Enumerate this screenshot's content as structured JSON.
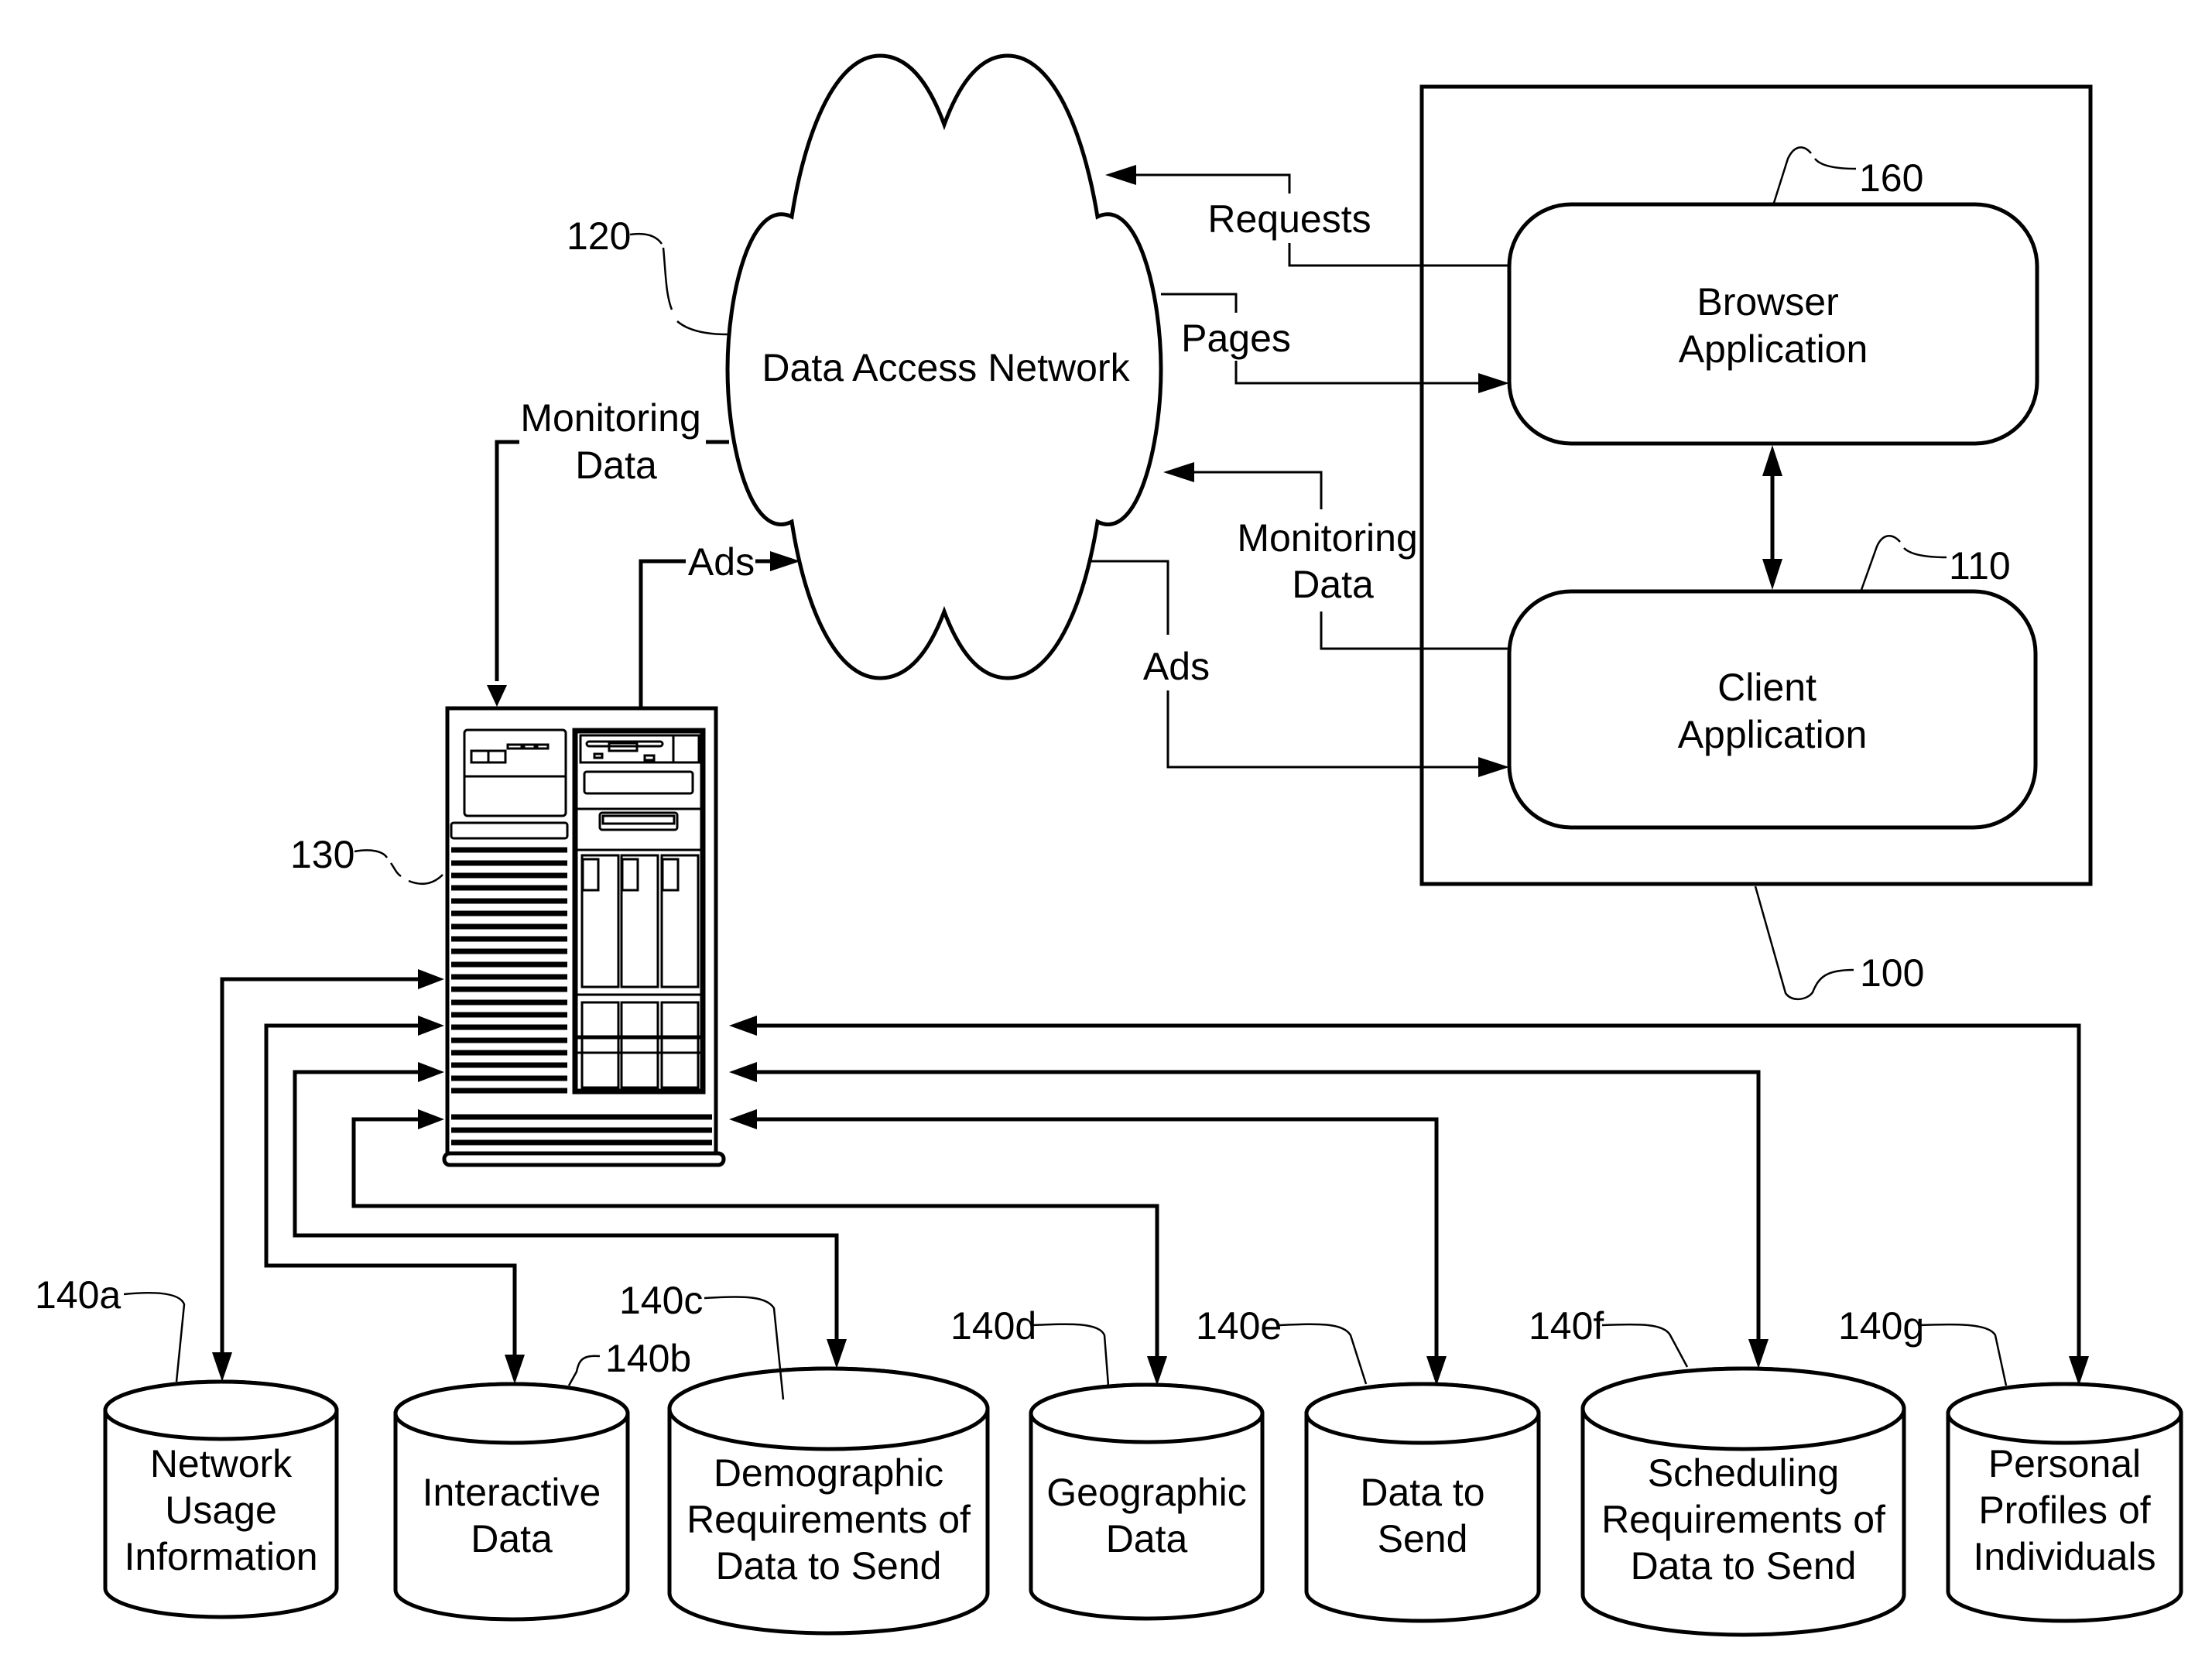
{
  "figure": {
    "type": "patent-block-diagram",
    "colors": {
      "line": "#000000",
      "background": "#ffffff"
    }
  },
  "network": {
    "ref": "120",
    "label": "Data Access Network"
  },
  "server": {
    "ref": "130",
    "icon": "server-tower-icon"
  },
  "client_system": {
    "ref": "100",
    "browser": {
      "ref": "160",
      "lines": [
        "Browser",
        "Application"
      ]
    },
    "client": {
      "ref": "110",
      "lines": [
        "Client",
        "Application"
      ]
    }
  },
  "flows": {
    "requests": "Requests",
    "pages": "Pages",
    "monitoring_right": [
      "Monitoring",
      "Data"
    ],
    "ads_right": "Ads",
    "monitoring_left": [
      "Monitoring",
      "Data"
    ],
    "ads_left": "Ads"
  },
  "databases": [
    {
      "ref": "140a",
      "lines": [
        "Network",
        "Usage",
        "Information"
      ]
    },
    {
      "ref": "140b",
      "lines": [
        "Interactive",
        "Data"
      ]
    },
    {
      "ref": "140c",
      "lines": [
        "Demographic",
        "Requirements of",
        "Data to Send"
      ]
    },
    {
      "ref": "140d",
      "lines": [
        "Geographic",
        "Data"
      ]
    },
    {
      "ref": "140e",
      "lines": [
        "Data to",
        "Send"
      ]
    },
    {
      "ref": "140f",
      "lines": [
        "Scheduling",
        "Requirements of",
        "Data to Send"
      ]
    },
    {
      "ref": "140g",
      "lines": [
        "Personal",
        "Profiles of",
        "Individuals"
      ]
    }
  ]
}
